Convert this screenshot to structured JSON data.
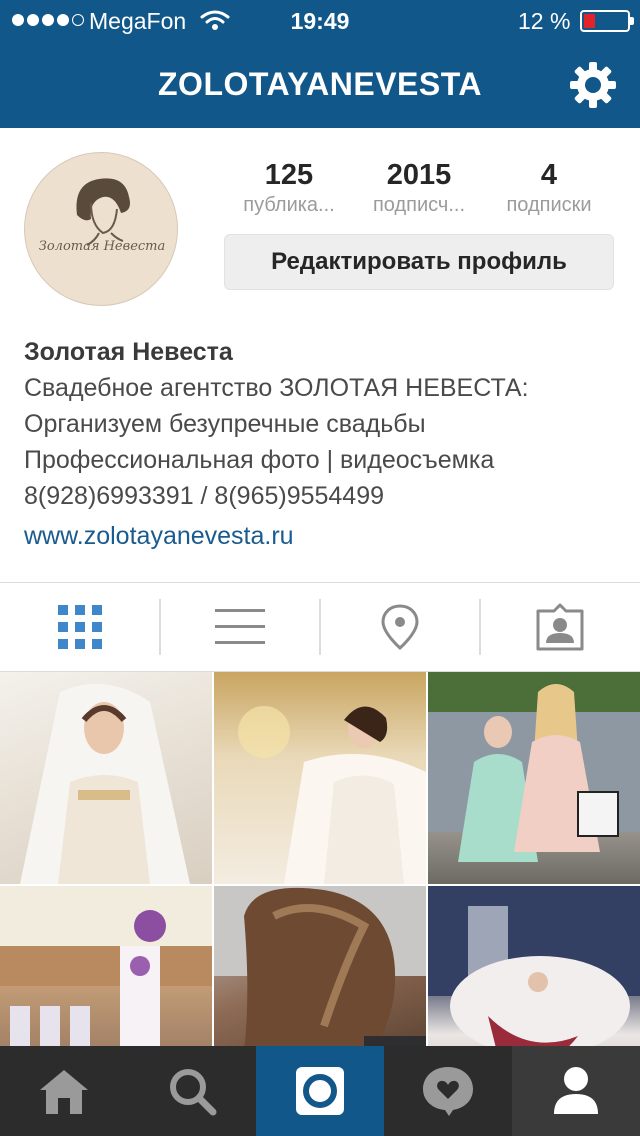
{
  "status_bar": {
    "carrier": "MegaFon",
    "time": "19:49",
    "battery_percent_label": "12 %",
    "battery_level": 0.12,
    "signal_bars_filled": 4,
    "signal_bars_total": 5
  },
  "nav": {
    "title": "ZOLOTAYANEVESTA",
    "settings_icon": "gear-icon"
  },
  "profile": {
    "avatar_text": "Золотая Невеста",
    "stats": [
      {
        "value": "125",
        "label": "публика..."
      },
      {
        "value": "2015",
        "label": "подписч..."
      },
      {
        "value": "4",
        "label": "подписки"
      }
    ],
    "edit_button_label": "Редактировать профиль",
    "name": "Золотая Невеста",
    "bio_lines": [
      "Свадебное агентство ЗОЛОТАЯ НЕВЕСТА:",
      "Организуем безупречные свадьбы",
      "Профессиональная фото | видеосъемка",
      "8(928)6993391 / 8(965)9554499"
    ],
    "website": "www.zolotayanevesta.ru"
  },
  "view_tabs": [
    {
      "icon": "grid-icon",
      "active": true
    },
    {
      "icon": "list-icon",
      "active": false
    },
    {
      "icon": "location-pin-icon",
      "active": false
    },
    {
      "icon": "tagged-person-icon",
      "active": false
    }
  ],
  "bottom_nav": [
    {
      "icon": "home-icon"
    },
    {
      "icon": "search-icon"
    },
    {
      "icon": "camera-icon"
    },
    {
      "icon": "activity-heart-icon"
    },
    {
      "icon": "profile-icon"
    }
  ],
  "colors": {
    "brand_blue": "#12578a",
    "active_tab_blue": "#3f87c9",
    "bottom_bar": "#2c2c2c",
    "battery_low": "#e0242a",
    "link": "#1a5b8f"
  }
}
